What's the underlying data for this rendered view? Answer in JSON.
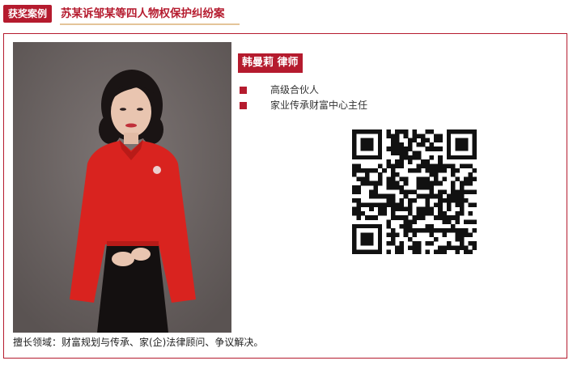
{
  "header": {
    "badge": "获奖案例",
    "title": "苏某诉邹某等四人物权保护纠纷案"
  },
  "lawyer": {
    "name": "韩曼莉 律师",
    "titles": [
      "高级合伙人",
      "家业传承财富中心主任"
    ],
    "expertise": "擅长领域：财富规划与传承、家(企)法律顾问、争议解决。"
  },
  "colors": {
    "accent": "#b51b2e",
    "underline": "#e4c59a",
    "photo_background": "#6e6766"
  },
  "icons": {
    "bullet": "square-bullet-icon",
    "qr": "qr-code-icon"
  }
}
